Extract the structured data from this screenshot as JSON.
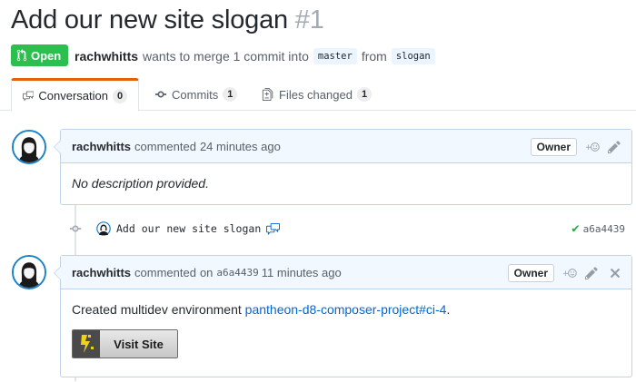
{
  "pr": {
    "title": "Add our new site slogan",
    "number": "#1",
    "state": "Open",
    "author": "rachwhitts",
    "merge_text": "wants to merge 1 commit into",
    "base_branch": "master",
    "from_text": "from",
    "head_branch": "slogan"
  },
  "tabs": [
    {
      "label": "Conversation",
      "count": "0",
      "icon": "comment-discussion-icon",
      "selected": true
    },
    {
      "label": "Commits",
      "count": "1",
      "icon": "git-commit-icon"
    },
    {
      "label": "Files changed",
      "count": "1",
      "icon": "file-diff-icon"
    }
  ],
  "comments": [
    {
      "author": "rachwhitts",
      "action": "commented",
      "on_text": "",
      "sha": "",
      "time": "24 minutes ago",
      "badge": "Owner",
      "body": "No description provided."
    },
    {
      "author": "rachwhitts",
      "action": "commented",
      "on_text": "on",
      "sha": "a6a4439",
      "time": "11 minutes ago",
      "badge": "Owner",
      "body_prefix": "Created multidev environment",
      "body_link": "pantheon-d8-composer-project#ci-4",
      "body_suffix": ".",
      "button_label": "Visit Site"
    }
  ],
  "commit": {
    "message": "Add our new site slogan",
    "sha": "a6a4439",
    "status": "success"
  },
  "colors": {
    "open_state": "#2cbe4e",
    "tab_accent": "#e36209",
    "link": "#0366d6",
    "comment_header": "#f1f8ff",
    "success": "#28a745"
  }
}
